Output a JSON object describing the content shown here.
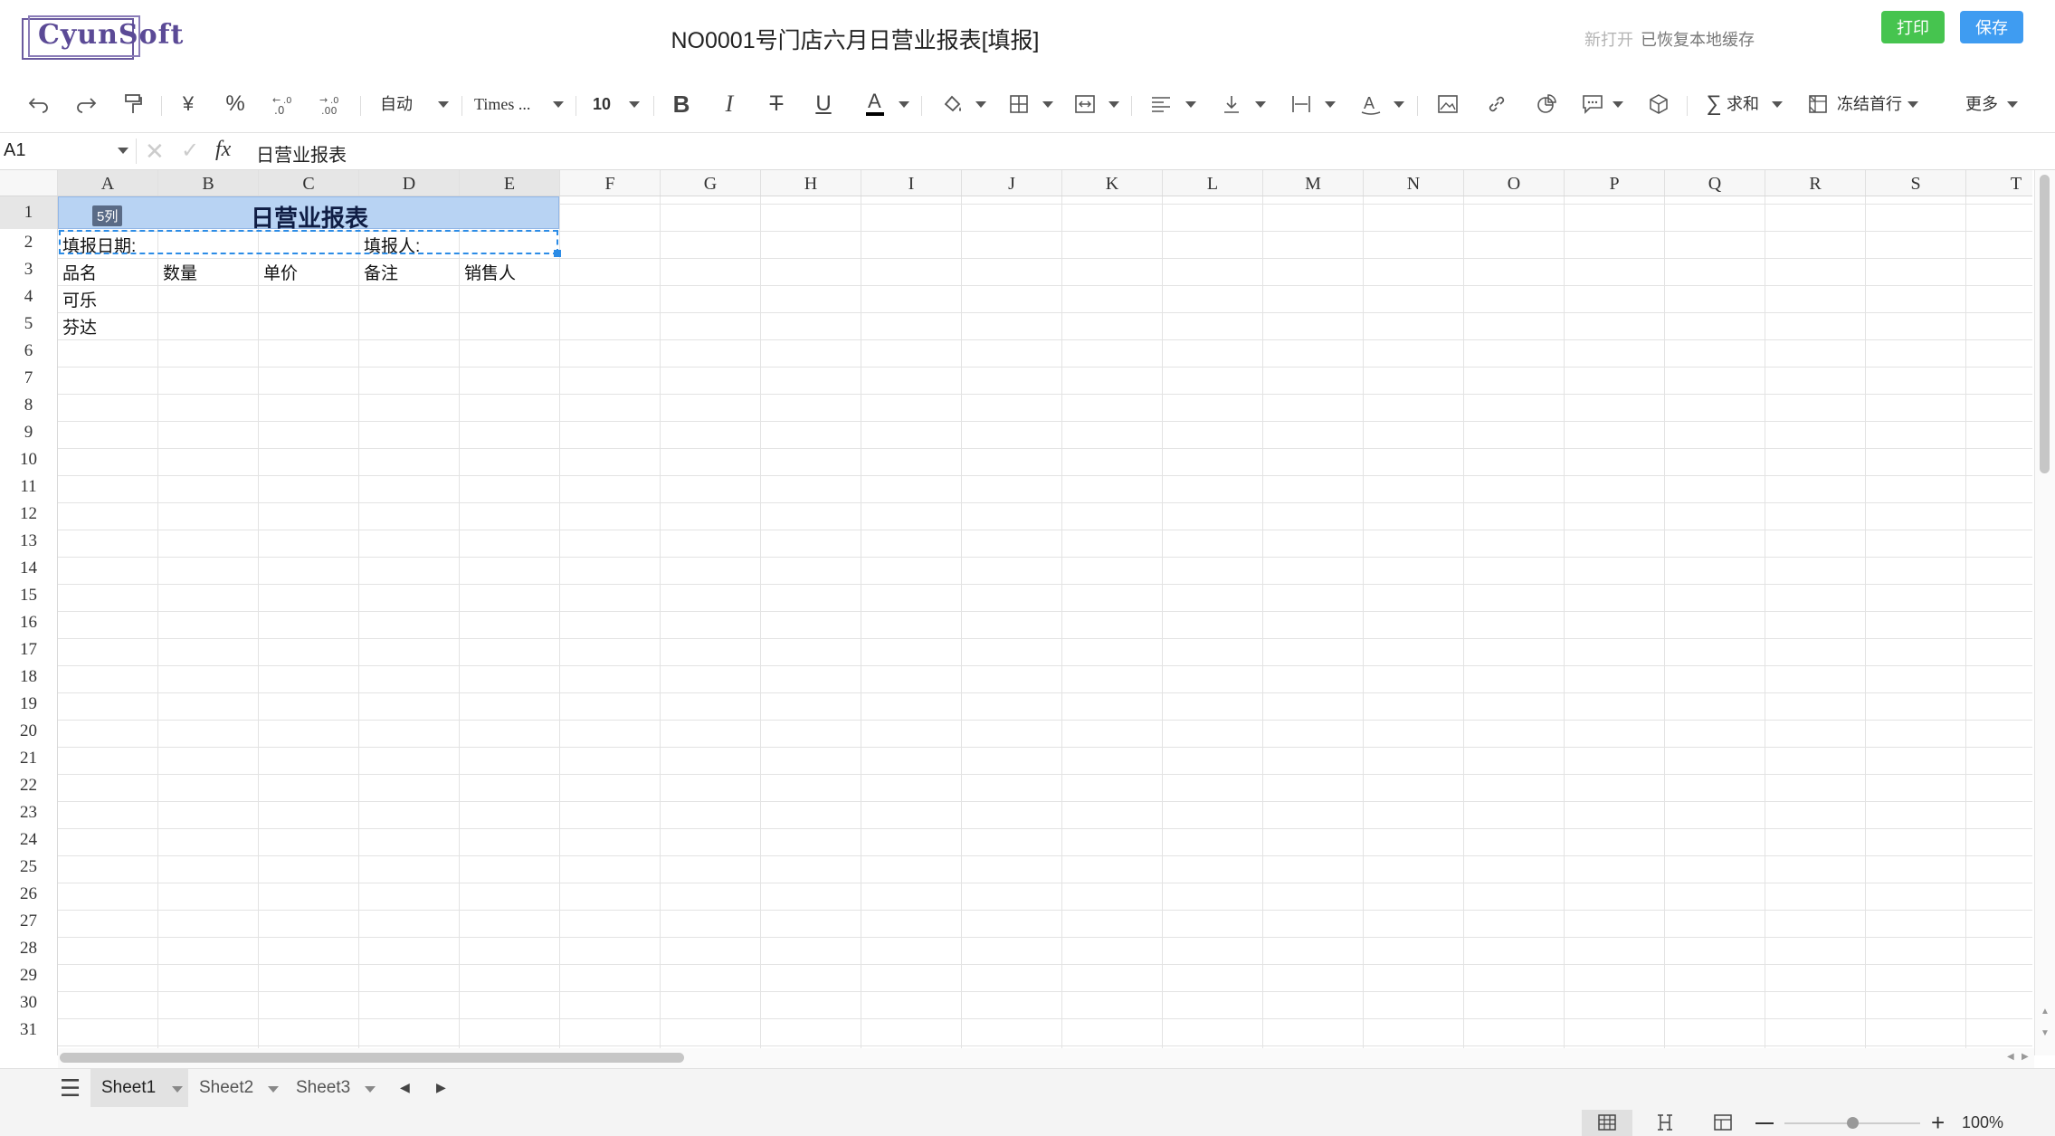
{
  "app": {
    "logo_text": "CyunSoft",
    "doc_title": "NO0001号门店六月日营业报表[填报]",
    "status_new": "新打开",
    "status_restored": "已恢复本地缓存",
    "print_label": "打印",
    "save_label": "保存"
  },
  "toolbar": {
    "currency": "¥",
    "percent": "%",
    "number_format": "自动",
    "font_name": "Times ...",
    "font_size": "10",
    "sum_label": "求和",
    "freeze_label": "冻结首行",
    "more_label": "更多",
    "text_color": "#000000",
    "brand_blue": "#3f9cf1",
    "brand_green": "#46c44f"
  },
  "formula_bar": {
    "cell_ref": "A1",
    "fx": "fx",
    "formula": "日营业报表"
  },
  "columns": [
    "A",
    "B",
    "C",
    "D",
    "E",
    "F",
    "G",
    "H",
    "I",
    "J",
    "K",
    "L",
    "M",
    "N",
    "O",
    "P",
    "Q",
    "R",
    "S",
    "T"
  ],
  "rows": [
    "1",
    "2",
    "3",
    "4",
    "5",
    "6",
    "7",
    "8",
    "9",
    "10",
    "11",
    "12",
    "13",
    "14",
    "15",
    "16",
    "17",
    "18",
    "19",
    "20",
    "21",
    "22",
    "23",
    "24",
    "25",
    "26",
    "27",
    "28",
    "29",
    "30",
    "31"
  ],
  "sheet": {
    "title": "日营业报表",
    "merge_badge": "5列",
    "fill_date_label": "填报日期:",
    "filler_label": "填报人:",
    "headers": [
      "品名",
      "数量",
      "单价",
      "备注",
      "销售人"
    ],
    "items": [
      "可乐",
      "芬达"
    ]
  },
  "sheets": [
    "Sheet1",
    "Sheet2",
    "Sheet3"
  ],
  "status": {
    "zoom": "100%",
    "zoom_fraction": 0.5
  }
}
